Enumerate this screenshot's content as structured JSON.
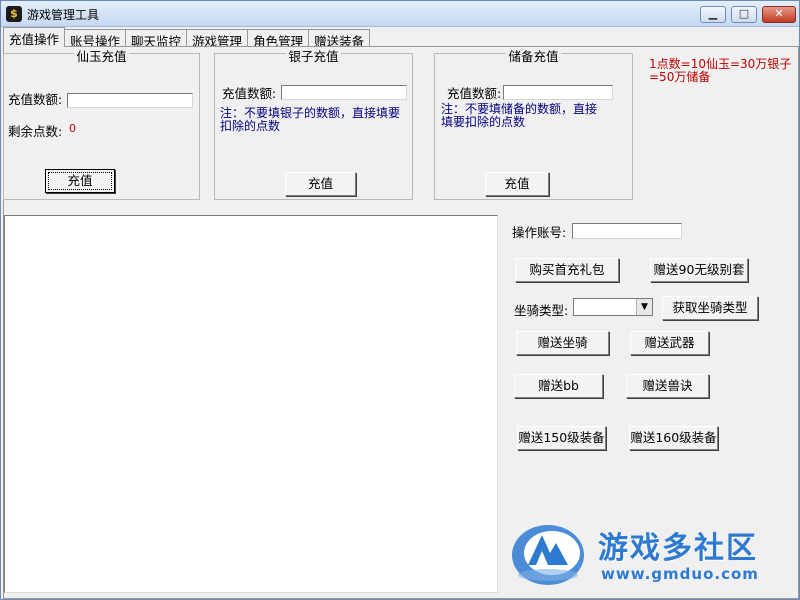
{
  "window": {
    "title": "游戏管理工具",
    "minimize_symbol": "▁",
    "maximize_symbol": "□",
    "close_symbol": "✕"
  },
  "tabs": [
    "充值操作",
    "账号操作",
    "聊天监控",
    "游戏管理",
    "角色管理",
    "赠送装备"
  ],
  "xianyu": {
    "title": "仙玉充值",
    "amount_label": "充值数额:",
    "amount_value": "",
    "remaining_label": "剩余点数:",
    "remaining_value": "0",
    "button": "充值"
  },
  "silver": {
    "title": "银子充值",
    "amount_label": "充值数额:",
    "amount_value": "",
    "note_line1": "注：不要填银子的数额，直接填要",
    "note_line2": "扣除的点数",
    "button": "充值"
  },
  "reserve": {
    "title": "储备充值",
    "amount_label": "充值数额:",
    "amount_value": "",
    "note_line1": "注：不要填储备的数额，直接",
    "note_line2": "填要扣除的点数",
    "button": "充值"
  },
  "rate_info": {
    "line1": "1点数=10仙玉=30万银子",
    "line2": "=50万储备"
  },
  "log": {
    "text": ""
  },
  "ops": {
    "account_label": "操作账号:",
    "account_value": "",
    "buy_first_pack": "购买首充礼包",
    "gift_90_outfit": "赠送90无级别套",
    "mount_type_label": "坐骑类型:",
    "mount_type_value": "",
    "get_mount_types": "获取坐骑类型",
    "gift_mount": "赠送坐骑",
    "gift_weapon": "赠送武器",
    "gift_bb": "赠送bb",
    "gift_beast_skill": "赠送兽诀",
    "gift_150_equip": "赠送150级装备",
    "gift_160_equip": "赠送160级装备"
  },
  "watermark": {
    "name": "游戏多社区",
    "url": "www.gmduo.com"
  },
  "colors": {
    "title_gradient_top": "#e3eefb",
    "close_button": "#c33a22",
    "note_text": "#000080",
    "rate_text": "#c00000",
    "watermark": "#2f7ad1"
  }
}
